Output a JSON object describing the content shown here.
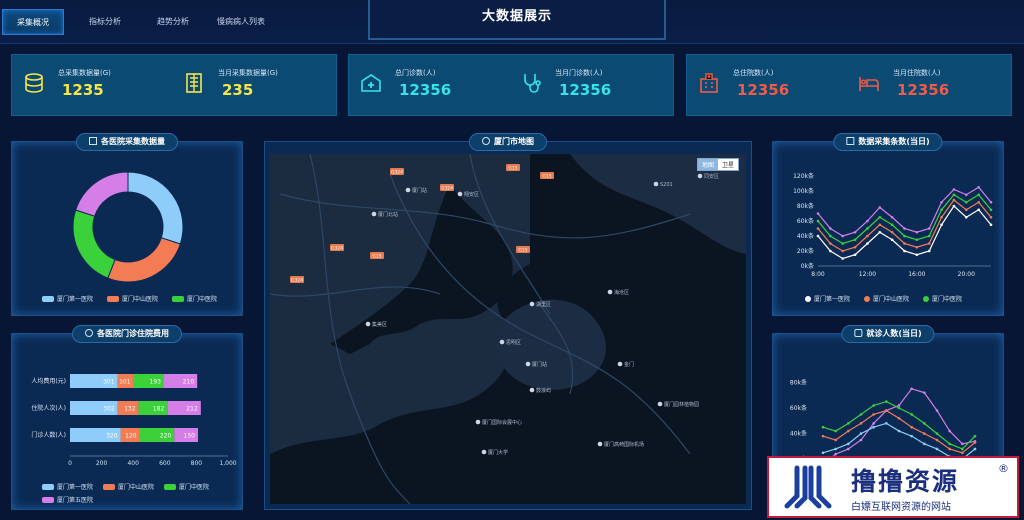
{
  "nav": {
    "tabs": [
      {
        "label": "采集概况",
        "active": true
      },
      {
        "label": "指标分析",
        "active": false
      },
      {
        "label": "趋势分析",
        "active": false
      },
      {
        "label": "慢病病人列表",
        "active": false
      }
    ],
    "title": "大数据展示"
  },
  "stats": [
    {
      "label": "总采集数据量(G)",
      "value": "1235",
      "icon": "database-icon",
      "color": "#f7e64a"
    },
    {
      "label": "当月采集数据量(G)",
      "value": "235",
      "icon": "server-icon",
      "color": "#f7e64a"
    },
    {
      "label": "总门诊数(人)",
      "value": "12356",
      "icon": "hospital-cross-icon",
      "color": "#36e4e8"
    },
    {
      "label": "当月门诊数(人)",
      "value": "12356",
      "icon": "stethoscope-icon",
      "color": "#36e4e8"
    },
    {
      "label": "总住院数(人)",
      "value": "12356",
      "icon": "building-icon",
      "color": "#f15b4a"
    },
    {
      "label": "当月住院数(人)",
      "value": "12356",
      "icon": "hospital-bed-icon",
      "color": "#f15b4a"
    }
  ],
  "panels": {
    "donut_title": "各医院采集数据量",
    "bar_title": "各医院门诊住院费用",
    "map_title": "厦门市地图",
    "line1_title": "数据采集条数(当日)",
    "line2_title": "就诊人数(当日)"
  },
  "map": {
    "switch": [
      "地图",
      "卫星"
    ],
    "labels": [
      "G324",
      "G15",
      "G324",
      "G15",
      "G324",
      "G15",
      "G15",
      "G324",
      "S201",
      "翔安区",
      "湖里区",
      "思明区",
      "厦门站",
      "集美区",
      "海沧区",
      "厦门国际会展中心",
      "厦门大学",
      "厦门站",
      "同安区",
      "厦门北站",
      "厦门高崎国际机场",
      "鼓浪屿",
      "厦门园林植物园",
      "金门"
    ]
  },
  "colors": {
    "blue": "#8ecdfa",
    "orange": "#f47c55",
    "green": "#3bd13b",
    "pink": "#d67ee8"
  },
  "watermark": {
    "big": "撸撸资源",
    "reg": "®",
    "small": "白嫖互联网资源的网站"
  },
  "chart_data": [
    {
      "type": "pie",
      "categories": [
        "厦门第一医院",
        "厦门中山医院",
        "厦门中医院",
        ""
      ],
      "values": [
        30,
        26,
        24,
        20
      ],
      "legend": [
        "厦门第一医院",
        "厦门中山医院",
        "厦门中医院"
      ],
      "legend_position": "bottom"
    },
    {
      "type": "bar",
      "orientation": "horizontal",
      "stacked": true,
      "categories": [
        "人均费用(元)",
        "住院人次(人)",
        "门诊人数(人)"
      ],
      "series": [
        {
          "name": "厦门第一医院",
          "values": [
            301,
            302,
            320
          ]
        },
        {
          "name": "厦门中山医院",
          "values": [
            101,
            132,
            120
          ]
        },
        {
          "name": "厦门中医院",
          "values": [
            193,
            182,
            220
          ]
        },
        {
          "name": "厦门第五医院",
          "values": [
            210,
            212,
            150
          ]
        }
      ],
      "xticks": [
        "0",
        "200",
        "400",
        "600",
        "800",
        "1,000"
      ],
      "xlim": [
        0,
        1000
      ],
      "legend_labels": [
        "厦门第一医院",
        "厦门中山医院",
        "厦门中医院",
        "厦门第五医院"
      ]
    },
    {
      "type": "line",
      "x": [
        "8:00",
        "9:00",
        "10:00",
        "11:00",
        "12:00",
        "13:00",
        "14:00",
        "15:00",
        "16:00",
        "17:00",
        "18:00",
        "19:00",
        "20:00",
        "21:00",
        "22:00"
      ],
      "xticks": [
        "8:00",
        "12:00",
        "16:00",
        "20:00"
      ],
      "yticks": [
        "0k条",
        "20k条",
        "40k条",
        "60k条",
        "80k条",
        "100k条",
        "120k条"
      ],
      "ylim": [
        0,
        120
      ],
      "series": [
        {
          "name": "厦门第一医院",
          "values": [
            40,
            20,
            10,
            15,
            30,
            45,
            35,
            20,
            15,
            20,
            55,
            80,
            65,
            75,
            55
          ]
        },
        {
          "name": "厦门中山医院",
          "values": [
            50,
            30,
            20,
            25,
            40,
            55,
            45,
            30,
            25,
            30,
            65,
            88,
            75,
            85,
            65
          ]
        },
        {
          "name": "厦门中医院",
          "values": [
            60,
            40,
            30,
            35,
            50,
            65,
            55,
            40,
            35,
            40,
            75,
            95,
            85,
            95,
            75
          ]
        },
        {
          "name": "",
          "values": [
            70,
            50,
            40,
            45,
            60,
            78,
            65,
            50,
            45,
            50,
            85,
            102,
            95,
            105,
            85
          ]
        }
      ],
      "legend_labels": [
        "厦门第一医院",
        "厦门中山医院",
        "厦门中医院"
      ]
    },
    {
      "type": "line",
      "x": [
        "1",
        "2",
        "3",
        "4",
        "5",
        "6",
        "7",
        "8",
        "9",
        "10",
        "11",
        "12",
        "13"
      ],
      "yticks": [
        "20k条",
        "40k条",
        "60k条",
        "80k条"
      ],
      "ylim": [
        10,
        85
      ],
      "series": [
        {
          "name": "",
          "values": [
            15,
            24,
            28,
            35,
            48,
            58,
            62,
            75,
            72,
            58,
            42,
            32,
            34
          ]
        },
        {
          "name": "",
          "values": [
            45,
            42,
            48,
            55,
            62,
            65,
            60,
            55,
            48,
            40,
            32,
            28,
            38
          ]
        },
        {
          "name": "",
          "values": [
            38,
            35,
            42,
            48,
            55,
            58,
            52,
            45,
            40,
            35,
            28,
            25,
            33
          ]
        },
        {
          "name": "",
          "values": [
            25,
            28,
            32,
            40,
            45,
            48,
            42,
            38,
            32,
            28,
            22,
            20,
            28
          ]
        }
      ]
    }
  ]
}
